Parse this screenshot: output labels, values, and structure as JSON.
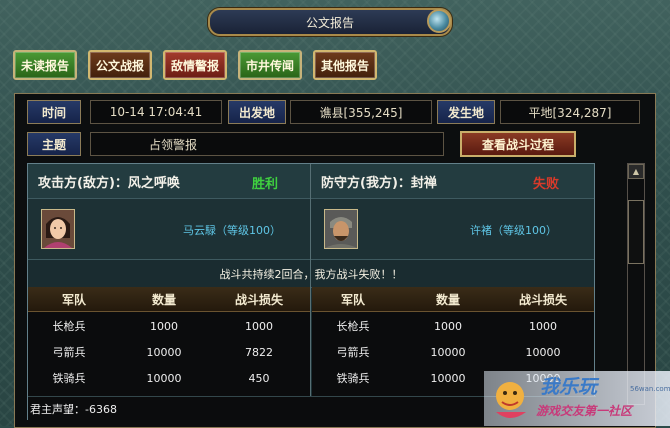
{
  "window": {
    "title": "公文报告"
  },
  "tabs": [
    {
      "label": "未读报告",
      "style": "green"
    },
    {
      "label": "公文战报",
      "style": "brown"
    },
    {
      "label": "敌情警报",
      "style": "red"
    },
    {
      "label": "市井传闻",
      "style": "green"
    },
    {
      "label": "其他报告",
      "style": "brown"
    }
  ],
  "info": {
    "time_label": "时间",
    "time_value": "10-14 17:04:41",
    "origin_label": "出发地",
    "origin_value": "谯县[355,245]",
    "target_label": "发生地",
    "target_value": "平地[324,287]",
    "subject_label": "主题",
    "subject_value": "占领警报",
    "replay_button": "查看战斗过程"
  },
  "report": {
    "attacker": {
      "title": "攻击方(敌方)：风之呼唤",
      "result": "胜利",
      "result_color": "#3fd03f",
      "general": "马云騄（等级100）"
    },
    "defender": {
      "title": "防守方(我方)：封禅",
      "result": "失败",
      "result_color": "#d83a2a",
      "general": "许褚（等级100）"
    },
    "summary": "战斗共持续2回合，我方战斗失败！！",
    "columns": [
      "军队",
      "数量",
      "战斗损失"
    ],
    "attacker_rows": [
      [
        "长枪兵",
        "1000",
        "1000"
      ],
      [
        "弓箭兵",
        "10000",
        "7822"
      ],
      [
        "铁骑兵",
        "10000",
        "450"
      ]
    ],
    "defender_rows": [
      [
        "长枪兵",
        "1000",
        "1000"
      ],
      [
        "弓箭兵",
        "10000",
        "10000"
      ],
      [
        "铁骑兵",
        "10000",
        "10000"
      ]
    ],
    "prestige": "君主声望：-6368"
  },
  "watermark": {
    "title": "我乐玩",
    "url": "56wan.com",
    "tagline": "游戏交友第一社区"
  }
}
